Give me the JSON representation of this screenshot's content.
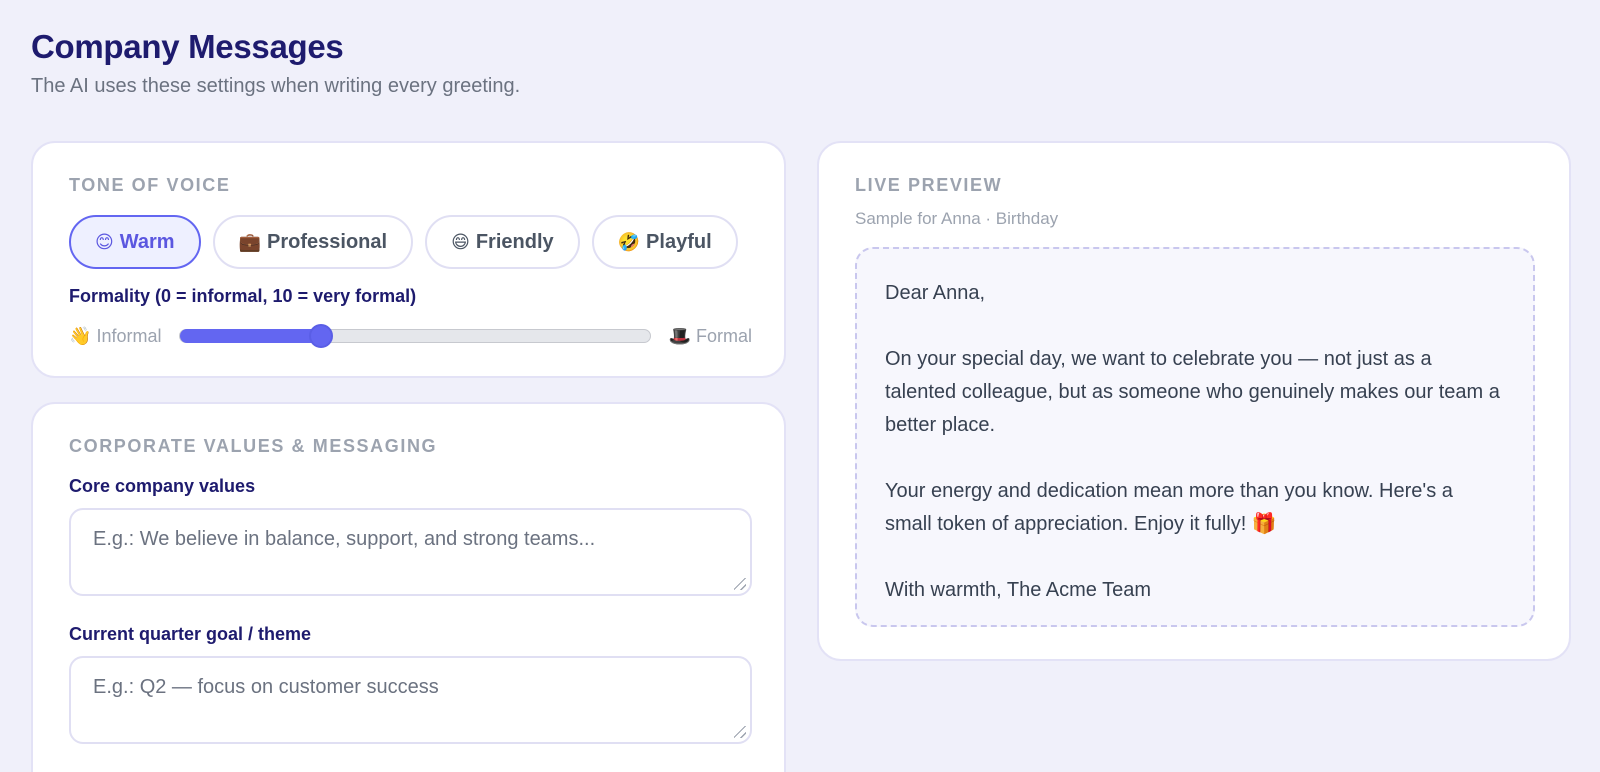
{
  "header": {
    "title": "Company Messages",
    "subtitle": "The AI uses these settings when writing every greeting."
  },
  "tone": {
    "section_label": "TONE OF VOICE",
    "options": [
      {
        "emoji": "😊",
        "label": "Warm",
        "selected": true
      },
      {
        "emoji": "💼",
        "label": "Professional",
        "selected": false
      },
      {
        "emoji": "😄",
        "label": "Friendly",
        "selected": false
      },
      {
        "emoji": "🤣",
        "label": "Playful",
        "selected": false
      }
    ],
    "formality_label": "Formality (0 = informal, 10 = very formal)",
    "formality_min_emoji": "👋",
    "formality_min_label": "Informal",
    "formality_max_emoji": "🎩",
    "formality_max_label": "Formal",
    "formality_value": 3,
    "formality_max": 10
  },
  "values": {
    "section_label": "CORPORATE VALUES & MESSAGING",
    "core_values_label": "Core company values",
    "core_values_placeholder": "E.g.: We believe in balance, support, and strong teams...",
    "quarter_goal_label": "Current quarter goal / theme",
    "quarter_goal_placeholder": "E.g.: Q2 — focus on customer success"
  },
  "preview": {
    "section_label": "LIVE PREVIEW",
    "sample_caption": "Sample for Anna · Birthday",
    "greeting": "Dear Anna,",
    "paragraph_1": "On your special day, we want to celebrate you — not just as a talented colleague, but as someone who genuinely makes our team a better place.",
    "paragraph_2": "Your energy and dedication mean more than you know. Here's a small token of appreciation. Enjoy it fully! 🎁",
    "signoff": "With warmth, The Acme Team"
  },
  "colors": {
    "accent": "#6366f1",
    "heading": "#1e1b6e",
    "background": "#f0f0fa"
  }
}
